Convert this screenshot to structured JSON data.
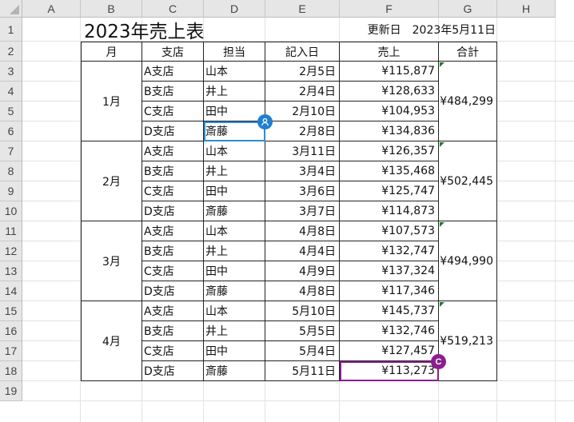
{
  "column_headers": [
    "A",
    "B",
    "C",
    "D",
    "E",
    "F",
    "G",
    "H"
  ],
  "row_numbers": [
    "1",
    "2",
    "3",
    "4",
    "5",
    "6",
    "7",
    "8",
    "9",
    "10",
    "11",
    "12",
    "13",
    "14",
    "15",
    "16",
    "17",
    "18",
    "19"
  ],
  "title": "2023年売上表",
  "updated_label": "更新日",
  "updated_date": "2023年5月11日",
  "table_headers": [
    "月",
    "支店",
    "担当",
    "記入日",
    "売上",
    "合計"
  ],
  "rows": [
    {
      "branch": "A支店",
      "person": "山本",
      "date": "2月5日",
      "sales": "¥115,877"
    },
    {
      "branch": "B支店",
      "person": "井上",
      "date": "2月4日",
      "sales": "¥128,633"
    },
    {
      "branch": "C支店",
      "person": "田中",
      "date": "2月10日",
      "sales": "¥104,953"
    },
    {
      "branch": "D支店",
      "person": "斎藤",
      "date": "2月8日",
      "sales": "¥134,836"
    },
    {
      "branch": "A支店",
      "person": "山本",
      "date": "3月11日",
      "sales": "¥126,357"
    },
    {
      "branch": "B支店",
      "person": "井上",
      "date": "3月4日",
      "sales": "¥135,468"
    },
    {
      "branch": "C支店",
      "person": "田中",
      "date": "3月6日",
      "sales": "¥125,747"
    },
    {
      "branch": "D支店",
      "person": "斎藤",
      "date": "3月7日",
      "sales": "¥114,873"
    },
    {
      "branch": "A支店",
      "person": "山本",
      "date": "4月8日",
      "sales": "¥107,573"
    },
    {
      "branch": "B支店",
      "person": "井上",
      "date": "4月4日",
      "sales": "¥132,747"
    },
    {
      "branch": "C支店",
      "person": "田中",
      "date": "4月9日",
      "sales": "¥137,324"
    },
    {
      "branch": "D支店",
      "person": "斎藤",
      "date": "4月8日",
      "sales": "¥117,346"
    },
    {
      "branch": "A支店",
      "person": "山本",
      "date": "5月10日",
      "sales": "¥145,737"
    },
    {
      "branch": "B支店",
      "person": "井上",
      "date": "5月5日",
      "sales": "¥132,746"
    },
    {
      "branch": "C支店",
      "person": "田中",
      "date": "5月4日",
      "sales": "¥127,457"
    },
    {
      "branch": "D支店",
      "person": "斎藤",
      "date": "5月11日",
      "sales": "¥113,273"
    }
  ],
  "groups": [
    {
      "month": "1月",
      "total": "¥484,299"
    },
    {
      "month": "2月",
      "total": "¥502,445"
    },
    {
      "month": "3月",
      "total": "¥494,990"
    },
    {
      "month": "4月",
      "total": "¥519,213"
    }
  ],
  "collaborators": [
    {
      "icon": "person-icon",
      "color": "#1f7fd1",
      "cell": "D6"
    },
    {
      "initial": "C",
      "color": "#8b1e8f",
      "cell": "F18"
    }
  ]
}
